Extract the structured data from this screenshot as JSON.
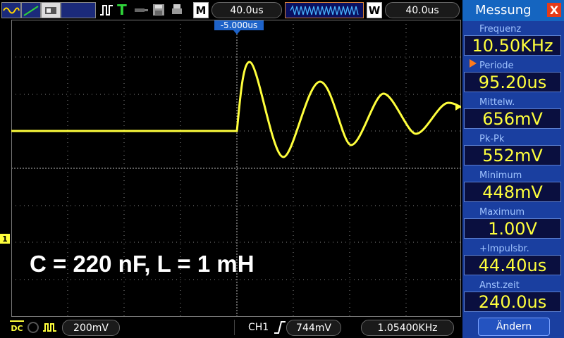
{
  "top_bar": {
    "m_label": "M",
    "timebase": "40.0us",
    "w_label": "W",
    "window_timebase": "40.0us",
    "trigger_offset": "-5.000us"
  },
  "screen": {
    "annotation": "C = 220 nF, L = 1 mH",
    "channel_marker": "1"
  },
  "bottom_bar": {
    "coupling": "DC",
    "volts_per_div": "200mV",
    "trigger_source": "CH1",
    "trigger_level": "744mV",
    "frequency_counter": "1.05400KHz"
  },
  "panel": {
    "title": "Messung",
    "close_label": "X",
    "measurements": [
      {
        "label": "Frequenz",
        "value": "10.50KHz"
      },
      {
        "label": "Periode",
        "value": "95.20us"
      },
      {
        "label": "Mittelw.",
        "value": "656mV"
      },
      {
        "label": "Pk-Pk",
        "value": "552mV"
      },
      {
        "label": "Minimum",
        "value": "448mV"
      },
      {
        "label": "Maximum",
        "value": "1.00V"
      },
      {
        "label": "+Impulsbr.",
        "value": "44.40us"
      },
      {
        "label": "Anst.zeit",
        "value": "240.0us"
      }
    ],
    "button_label": "Ändern"
  },
  "colors": {
    "trace": "#ffff3c",
    "panel_bg": "#1a3fa0",
    "value_text": "#ffff3c",
    "close_bg": "#e53b1a",
    "trigger_arrow": "#ff7a1a"
  }
}
